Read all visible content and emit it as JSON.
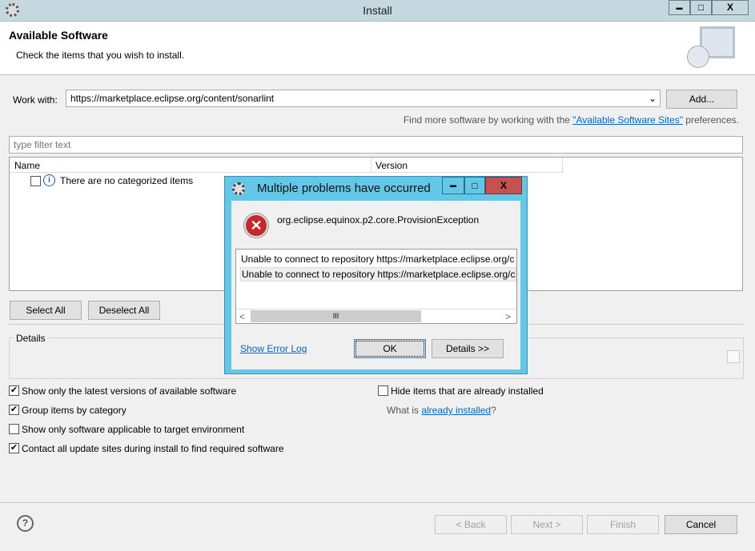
{
  "window": {
    "title": "Install",
    "min": "▬",
    "max": "□",
    "close": "X"
  },
  "header": {
    "title": "Available Software",
    "subtitle": "Check the items that you wish to install."
  },
  "work_with": {
    "label": "Work with:",
    "value": "https://marketplace.eclipse.org/content/sonarlint",
    "add": "Add...",
    "hint_prefix": "Find more software by working with the ",
    "hint_link": "\"Available Software Sites\"",
    "hint_suffix": " preferences."
  },
  "filter": {
    "placeholder": "type filter text"
  },
  "table": {
    "columns": [
      "Name",
      "Version"
    ],
    "rows": [
      "There are no categorized items"
    ]
  },
  "buttons": {
    "select_all": "Select All",
    "deselect_all": "Deselect All"
  },
  "details": {
    "label": "Details"
  },
  "options": [
    {
      "label": "Show only the latest versions of available software",
      "checked": true
    },
    {
      "label": "Group items by category",
      "checked": true
    },
    {
      "label": "Show only software applicable to target environment",
      "checked": false
    },
    {
      "label": "Contact all update sites during install to find required software",
      "checked": true
    },
    {
      "label": "Hide items that are already installed",
      "checked": false
    }
  ],
  "what_is": {
    "prefix": "What is ",
    "link": "already installed",
    "suffix": "?"
  },
  "footer": {
    "help": "?",
    "back": "< Back",
    "next": "Next >",
    "finish": "Finish",
    "cancel": "Cancel"
  },
  "dialog": {
    "title": "Multiple problems have occurred",
    "exception": "org.eclipse.equinox.p2.core.ProvisionException",
    "messages": [
      "Unable to connect to repository https://marketplace.eclipse.org/c",
      "Unable to connect to repository https://marketplace.eclipse.org/c"
    ],
    "show_log": "Show Error Log",
    "ok": "OK",
    "details": "Details >>",
    "min": "▬",
    "max": "□",
    "close": "X",
    "scroll_left": "<",
    "scroll_right": ">",
    "scroll_grip": "III"
  }
}
